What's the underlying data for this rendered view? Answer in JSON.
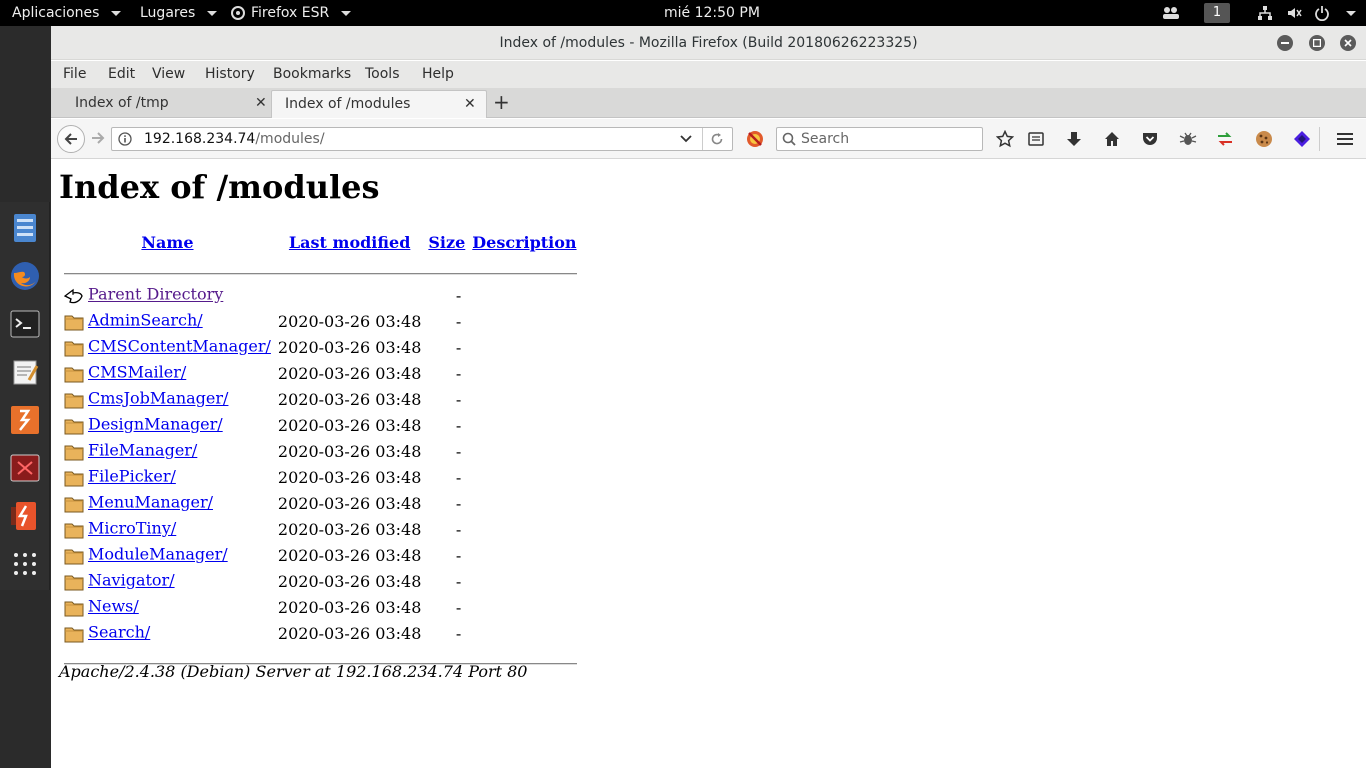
{
  "topbar": {
    "apps_label": "Aplicaciones",
    "places_label": "Lugares",
    "app_menu_label": "Firefox ESR",
    "clock": "mié 12:50 PM",
    "workspace": "1"
  },
  "window": {
    "title": "Index of /modules - Mozilla Firefox (Build 20180626223325)"
  },
  "menubar": {
    "items": [
      "File",
      "Edit",
      "View",
      "History",
      "Bookmarks",
      "Tools",
      "Help"
    ]
  },
  "tabs": [
    {
      "label": "Index of /tmp",
      "active": false
    },
    {
      "label": "Index of /modules",
      "active": true
    }
  ],
  "navbar": {
    "url_host": "192.168.234.74",
    "url_path": "/modules/",
    "search_placeholder": "Search"
  },
  "page": {
    "title": "Index of /modules",
    "columns": {
      "name": "Name",
      "modified": "Last modified",
      "size": "Size",
      "description": "Description"
    },
    "parent": {
      "name": "Parent Directory",
      "modified": "",
      "size": "-"
    },
    "rows": [
      {
        "name": "AdminSearch/",
        "modified": "2020-03-26 03:48",
        "size": "-"
      },
      {
        "name": "CMSContentManager/",
        "modified": "2020-03-26 03:48",
        "size": "-"
      },
      {
        "name": "CMSMailer/",
        "modified": "2020-03-26 03:48",
        "size": "-"
      },
      {
        "name": "CmsJobManager/",
        "modified": "2020-03-26 03:48",
        "size": "-"
      },
      {
        "name": "DesignManager/",
        "modified": "2020-03-26 03:48",
        "size": "-"
      },
      {
        "name": "FileManager/",
        "modified": "2020-03-26 03:48",
        "size": "-"
      },
      {
        "name": "FilePicker/",
        "modified": "2020-03-26 03:48",
        "size": "-"
      },
      {
        "name": "MenuManager/",
        "modified": "2020-03-26 03:48",
        "size": "-"
      },
      {
        "name": "MicroTiny/",
        "modified": "2020-03-26 03:48",
        "size": "-"
      },
      {
        "name": "ModuleManager/",
        "modified": "2020-03-26 03:48",
        "size": "-"
      },
      {
        "name": "Navigator/",
        "modified": "2020-03-26 03:48",
        "size": "-"
      },
      {
        "name": "News/",
        "modified": "2020-03-26 03:48",
        "size": "-"
      },
      {
        "name": "Search/",
        "modified": "2020-03-26 03:48",
        "size": "-"
      }
    ],
    "address": "Apache/2.4.38 (Debian) Server at 192.168.234.74 Port 80"
  },
  "icons": {
    "folder": "folder-icon",
    "parent": "back-arrow-icon"
  },
  "colors": {
    "link": "#0000ee",
    "visited_link": "#551a8b",
    "folder": "#e9b35b"
  }
}
